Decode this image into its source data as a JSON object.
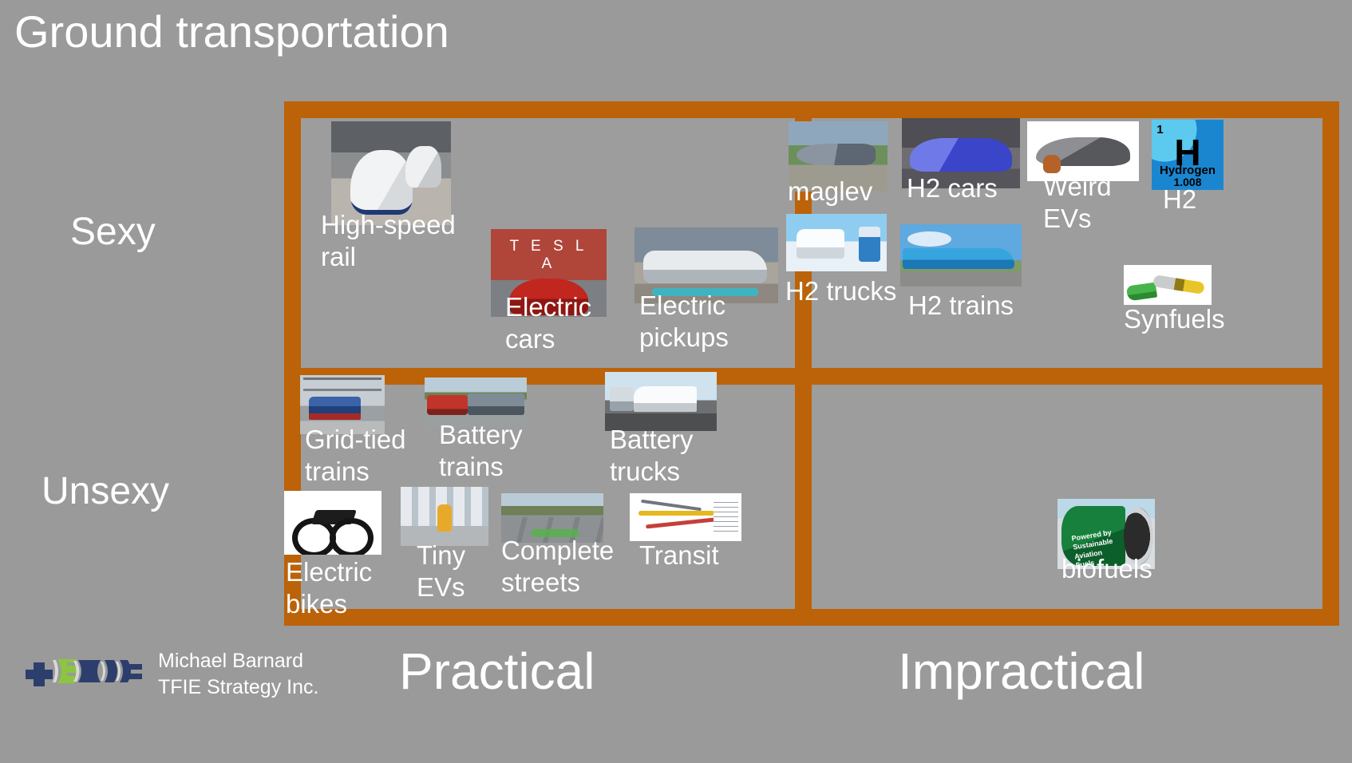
{
  "slide": {
    "title": "Ground transportation",
    "background_color": "#9a9a9a",
    "frame_color": "#BC6208",
    "text_color": "#ffffff"
  },
  "axes": {
    "y_top_label": "Sexy",
    "y_bottom_label": "Unsexy",
    "x_left_label": "Practical",
    "x_right_label": "Impractical"
  },
  "quadrants": {
    "top_left": {
      "name": "Sexy / Practical",
      "items": [
        {
          "label": "High-speed\nrail",
          "image": "high-speed-train-photo"
        },
        {
          "label": "Electric\ncars",
          "image": "tesla-storefront-red-car-photo"
        },
        {
          "label": "Electric\npickups",
          "image": "electric-pickup-truck-photo"
        }
      ]
    },
    "top_right": {
      "name": "Sexy / Impractical",
      "items": [
        {
          "label": "maglev",
          "image": "maglev-train-photo"
        },
        {
          "label": "H2 cars",
          "image": "blue-hydrogen-car-photo"
        },
        {
          "label": "Weird\nEVs",
          "image": "aptera-three-wheel-ev-photo"
        },
        {
          "label": "H2",
          "image": "hydrogen-periodic-element-tile"
        },
        {
          "label": "H2 trucks",
          "image": "hydrogen-semi-truck-photo"
        },
        {
          "label": "H2 trains",
          "image": "hydrogen-tram-photo"
        },
        {
          "label": "Synfuels",
          "image": "fuel-nozzle-photo"
        }
      ]
    },
    "bottom_left": {
      "name": "Unsexy / Practical",
      "items": [
        {
          "label": "Grid-tied\ntrains",
          "image": "electric-locomotive-photo"
        },
        {
          "label": "Battery\ntrains",
          "image": "battery-locomotive-photo"
        },
        {
          "label": "Battery\ntrucks",
          "image": "electric-semi-truck-photo"
        },
        {
          "label": "Electric\nbikes",
          "image": "electric-bicycle-photo"
        },
        {
          "label": "Tiny\nEVs",
          "image": "electric-scooter-rider-photo"
        },
        {
          "label": "Complete\nstreets",
          "image": "complete-street-photo"
        },
        {
          "label": "Transit",
          "image": "transit-network-map"
        }
      ]
    },
    "bottom_right": {
      "name": "Unsexy / Impractical",
      "items": [
        {
          "label": "biofuels",
          "image": "sustainable-aviation-fuel-engine-photo"
        }
      ]
    }
  },
  "hydrogen_tile": {
    "atomic_number": "1",
    "symbol": "H",
    "element_name": "Hydrogen",
    "atomic_weight": "1.008"
  },
  "tesla_thumb": {
    "wordmark": "T E S L A"
  },
  "biofuel_thumb": {
    "caption_line1": "Powered by",
    "caption_line2": "Sustainable",
    "caption_line3": "Aviation",
    "caption_line4": "Fuels"
  },
  "footer": {
    "author": "Michael Barnard",
    "company": "TFIE Strategy Inc.",
    "logo_name": "tfie-logo",
    "logo_colors": {
      "navy": "#2c3e6b",
      "green": "#8cc63e",
      "light": "#d8d8d8"
    }
  }
}
